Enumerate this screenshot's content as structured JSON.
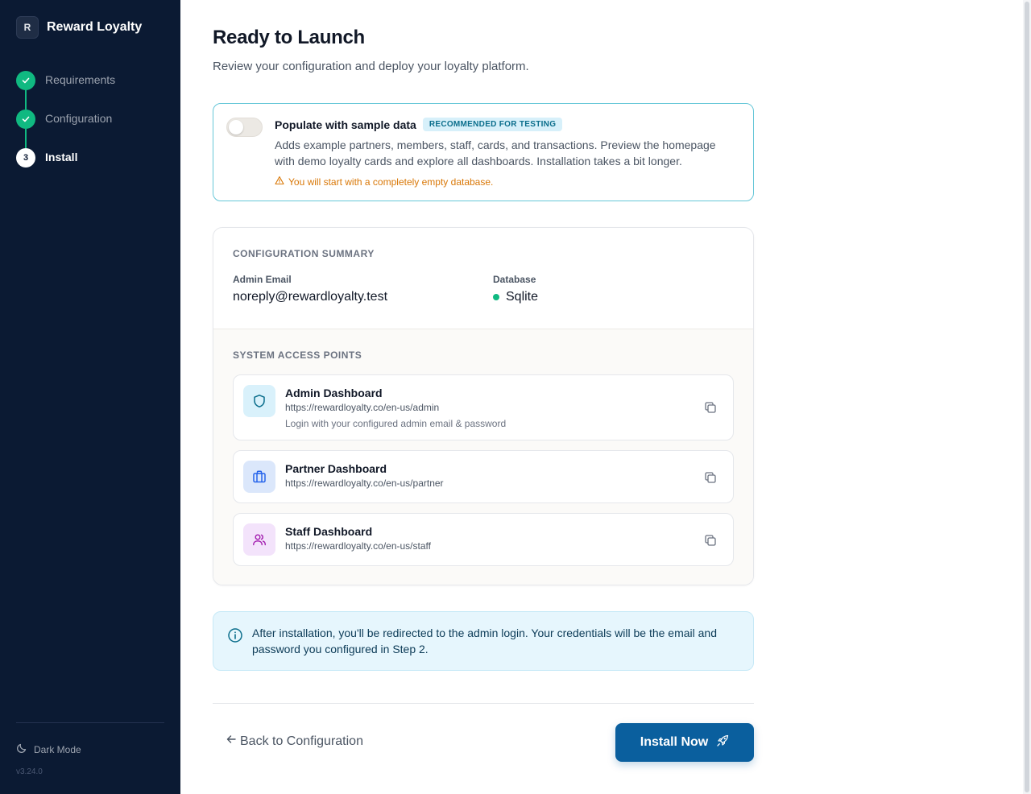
{
  "brand": {
    "logo_letter": "R",
    "name": "Reward Loyalty"
  },
  "steps": [
    {
      "label": "Requirements",
      "state": "done"
    },
    {
      "label": "Configuration",
      "state": "done"
    },
    {
      "label": "Install",
      "number": "3",
      "state": "current"
    }
  ],
  "sidebar_footer": {
    "dark_mode_label": "Dark Mode",
    "version": "v3.24.0"
  },
  "header": {
    "title": "Ready to Launch",
    "subtitle": "Review your configuration and deploy your loyalty platform."
  },
  "sample_data": {
    "toggle_on": false,
    "title": "Populate with sample data",
    "badge": "RECOMMENDED FOR TESTING",
    "description": "Adds example partners, members, staff, cards, and transactions. Preview the homepage with demo loyalty cards and explore all dashboards. Installation takes a bit longer.",
    "warning": "You will start with a completely empty database."
  },
  "summary": {
    "section_title": "CONFIGURATION SUMMARY",
    "admin_email_label": "Admin Email",
    "admin_email": "noreply@rewardloyalty.test",
    "database_label": "Database",
    "database": "Sqlite"
  },
  "access_points": {
    "section_title": "SYSTEM ACCESS POINTS",
    "items": [
      {
        "title": "Admin Dashboard",
        "url": "https://rewardloyalty.co/en-us/admin",
        "note": "Login with your configured admin email & password",
        "icon": "shield-icon"
      },
      {
        "title": "Partner Dashboard",
        "url": "https://rewardloyalty.co/en-us/partner",
        "icon": "briefcase-icon"
      },
      {
        "title": "Staff Dashboard",
        "url": "https://rewardloyalty.co/en-us/staff",
        "icon": "users-icon"
      }
    ]
  },
  "info": {
    "text": "After installation, you'll be redirected to the admin login. Your credentials will be the email and password you configured in Step 2."
  },
  "actions": {
    "back_label": "Back to Configuration",
    "install_label": "Install Now"
  },
  "colors": {
    "sidebar_bg": "#0b1a33",
    "step_done": "#10b981",
    "accent_border": "#67c7d8",
    "warning": "#d97706",
    "primary_button": "#0a5f9e",
    "info_bg": "#e6f6fd"
  }
}
